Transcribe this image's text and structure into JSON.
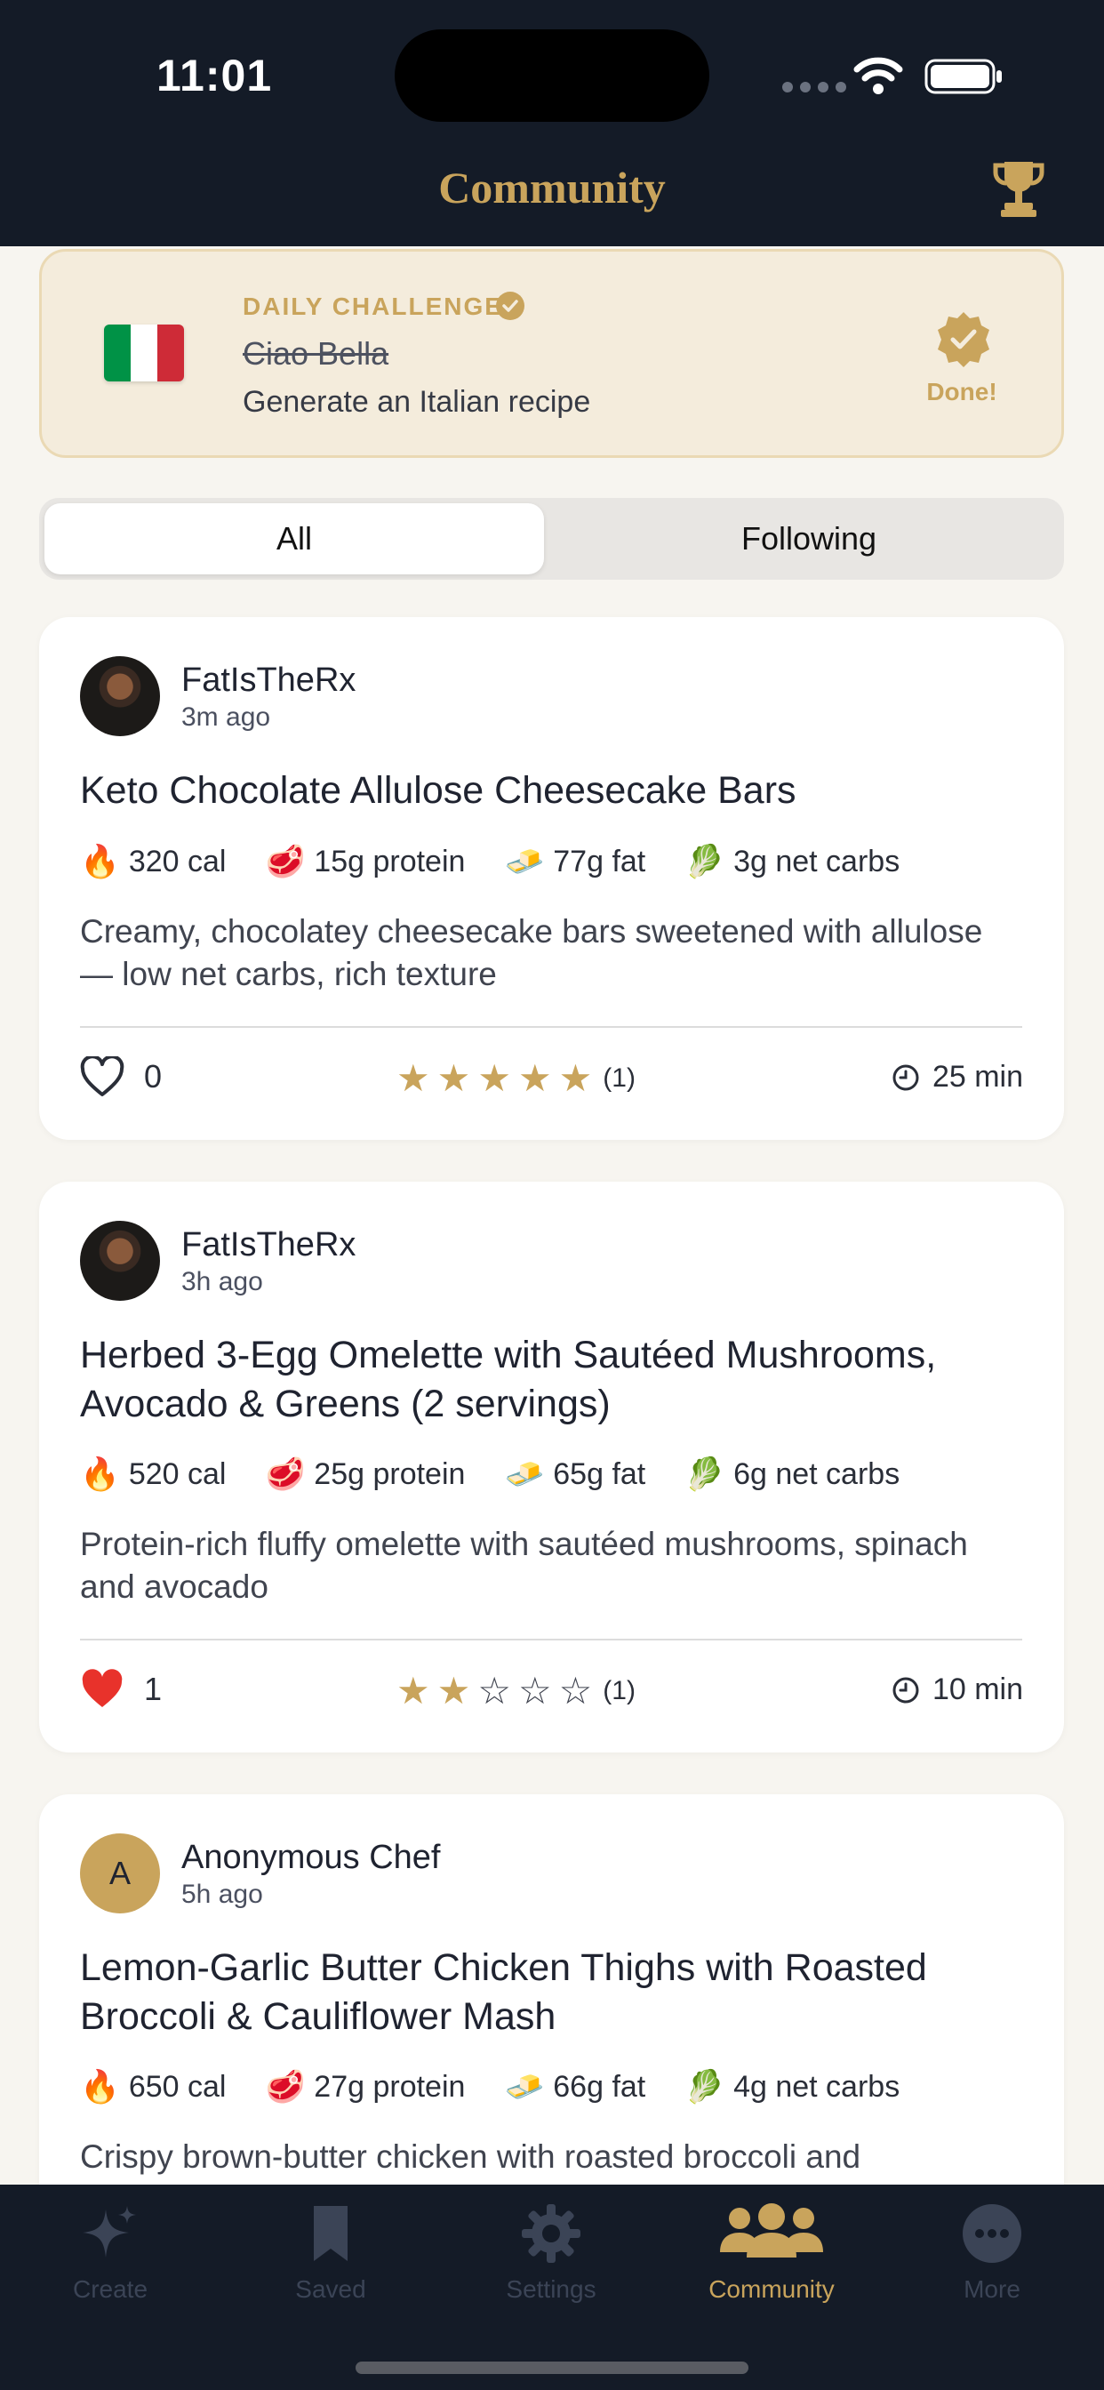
{
  "status_bar": {
    "time": "11:01"
  },
  "header": {
    "title": "Community"
  },
  "challenge": {
    "label": "DAILY CHALLENGE",
    "name": "Ciao Bella",
    "description": "Generate an Italian recipe",
    "done_label": "Done!",
    "flag_colors": [
      "#009246",
      "#ffffff",
      "#ce2b37"
    ]
  },
  "segments": {
    "all": "All",
    "following": "Following"
  },
  "posts": [
    {
      "author": "FatIsTheRx",
      "time_ago": "3m ago",
      "title": "Keto Chocolate Allulose Cheesecake Bars",
      "calories": "320 cal",
      "protein": "15g protein",
      "fat": "77g fat",
      "carbs": "3g net carbs",
      "description": "Creamy, chocolatey cheesecake bars sweetened with allulose — low net carbs, rich texture",
      "likes": "0",
      "liked": false,
      "rating": 5,
      "rating_count": "(1)",
      "duration": "25 min"
    },
    {
      "author": "FatIsTheRx",
      "time_ago": "3h ago",
      "title": "Herbed 3-Egg Omelette with Sautéed Mushrooms, Avocado & Greens (2 servings)",
      "calories": "520 cal",
      "protein": "25g protein",
      "fat": "65g fat",
      "carbs": "6g net carbs",
      "description": "Protein-rich fluffy omelette with sautéed mushrooms, spinach and avocado",
      "likes": "1",
      "liked": true,
      "rating": 2,
      "rating_count": "(1)",
      "duration": "10 min"
    },
    {
      "author": "Anonymous Chef",
      "avatar_letter": "A",
      "time_ago": "5h ago",
      "title": "Lemon-Garlic Butter Chicken Thighs with Roasted Broccoli & Cauliflower Mash",
      "calories": "650 cal",
      "protein": "27g protein",
      "fat": "66g fat",
      "carbs": "4g net carbs",
      "description": "Crispy brown-butter chicken with roasted broccoli and"
    }
  ],
  "tabs": [
    {
      "label": "Create",
      "icon": "sparkle-icon"
    },
    {
      "label": "Saved",
      "icon": "bookmark-icon"
    },
    {
      "label": "Settings",
      "icon": "gear-icon"
    },
    {
      "label": "Community",
      "icon": "people-icon",
      "active": true
    },
    {
      "label": "More",
      "icon": "more-icon"
    }
  ],
  "colors": {
    "accent": "#c9a45c",
    "nav_bg": "#141b27",
    "like_red": "#e8322b"
  }
}
